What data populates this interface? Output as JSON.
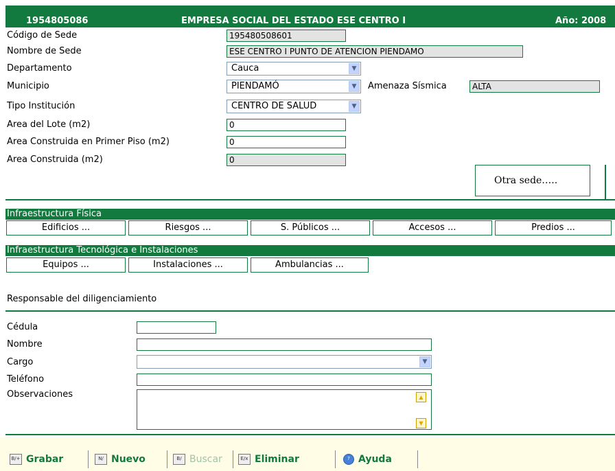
{
  "header": {
    "code": "1954805086",
    "name": "EMPRESA SOCIAL DEL ESTADO ESE CENTRO I",
    "year": "Año: 2008"
  },
  "fields": {
    "codigo_sede": {
      "label": "Código de Sede",
      "value": "195480508601"
    },
    "nombre_sede": {
      "label": "Nombre de Sede",
      "value": "ESE CENTRO I PUNTO DE ATENCION PIENDAMO"
    },
    "departamento": {
      "label": "Departamento",
      "value": "Cauca"
    },
    "municipio": {
      "label": "Municipio",
      "value": "PIENDAMÓ"
    },
    "amenaza": {
      "label": "Amenaza Sísmica",
      "value": "ALTA"
    },
    "tipo_institucion": {
      "label": "Tipo Institución",
      "value": "CENTRO DE SALUD"
    },
    "area_lote": {
      "label": "Area del Lote (m2)",
      "value": "0"
    },
    "area_primer_piso": {
      "label": "Area Construida en Primer Piso (m2)",
      "value": "0"
    },
    "area_construida": {
      "label": "Area Construida (m2)",
      "value": "0"
    }
  },
  "note": "Otra sede…..",
  "infra_fisica": {
    "title": "Infraestructura Física",
    "buttons": [
      "Edificios ...",
      "Riesgos ...",
      "S. Públicos ...",
      "Accesos ...",
      "Predios ..."
    ]
  },
  "infra_tec": {
    "title": "Infraestructura Tecnológica e Instalaciones",
    "buttons": [
      "Equipos ...",
      "Instalaciones ...",
      "Ambulancias ..."
    ]
  },
  "responsable": {
    "title": "Responsable del diligenciamiento",
    "cedula": "Cédula",
    "nombre": "Nombre",
    "cargo": "Cargo",
    "telefono": "Teléfono",
    "observaciones": "Observaciones"
  },
  "toolbar": {
    "grabar": "Grabar",
    "nuevo": "Nuevo",
    "buscar": "Buscar",
    "eliminar": "Eliminar",
    "ayuda": "Ayuda"
  },
  "colors": {
    "primary": "#127a3e",
    "readonly": "#e3e3e3",
    "footer": "#fffde6"
  }
}
